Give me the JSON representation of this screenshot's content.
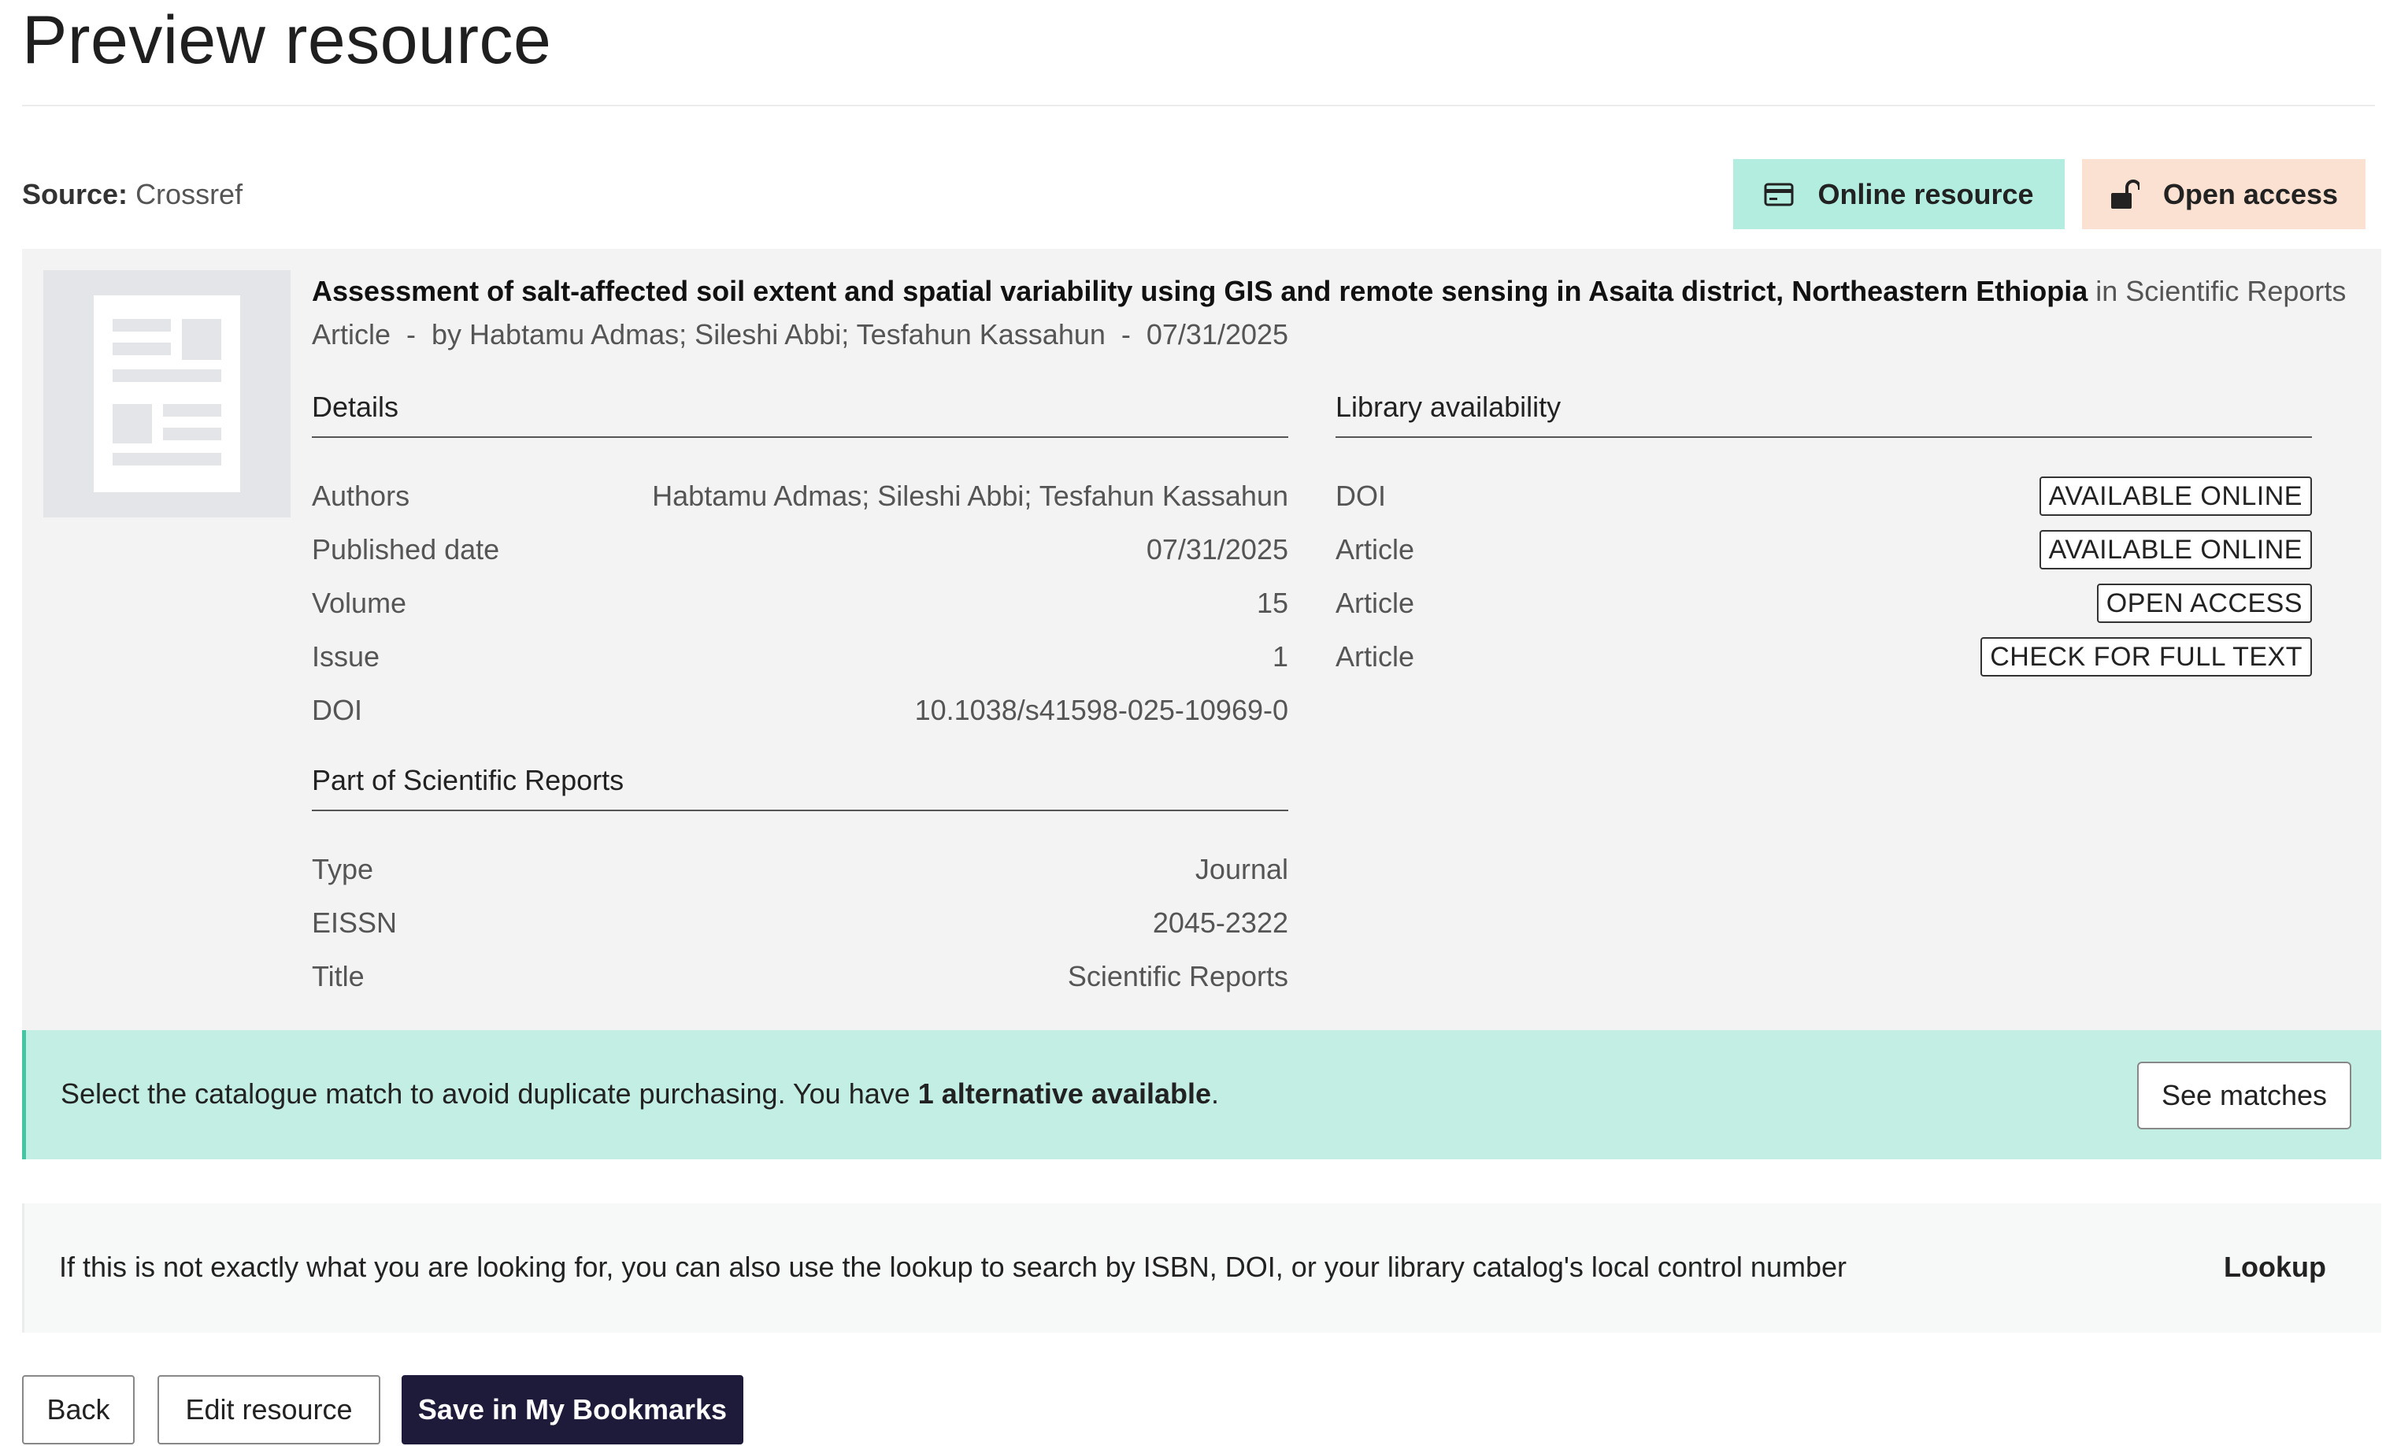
{
  "page": {
    "title": "Preview resource"
  },
  "source": {
    "label": "Source:",
    "value": "Crossref"
  },
  "pills": {
    "online": {
      "label": "Online resource",
      "icon": "credit-card-icon",
      "color": "#b3ede0"
    },
    "open_access": {
      "label": "Open access",
      "icon": "unlock-icon",
      "color": "#fbe1d1"
    }
  },
  "resource": {
    "title": "Assessment of salt-affected soil extent and spatial variability using GIS and remote sensing in Asaita district, Northeastern Ethiopia",
    "in_text": "in Scientific Reports",
    "meta": "Article  -  by Habtamu Admas; Sileshi Abbi; Tesfahun Kassahun  -  07/31/2025"
  },
  "details": {
    "heading": "Details",
    "rows": [
      {
        "label": "Authors",
        "value": "Habtamu Admas; Sileshi Abbi; Tesfahun Kassahun"
      },
      {
        "label": "Published date",
        "value": "07/31/2025"
      },
      {
        "label": "Volume",
        "value": "15"
      },
      {
        "label": "Issue",
        "value": "1"
      },
      {
        "label": "DOI",
        "value": "10.1038/s41598-025-10969-0"
      }
    ]
  },
  "part_of": {
    "heading": "Part of Scientific Reports",
    "rows": [
      {
        "label": "Type",
        "value": "Journal"
      },
      {
        "label": "EISSN",
        "value": "2045-2322"
      },
      {
        "label": "Title",
        "value": "Scientific Reports"
      }
    ]
  },
  "library": {
    "heading": "Library availability",
    "rows": [
      {
        "label": "DOI",
        "badge": "AVAILABLE ONLINE"
      },
      {
        "label": "Article",
        "badge": "AVAILABLE ONLINE"
      },
      {
        "label": "Article",
        "badge": "OPEN ACCESS"
      },
      {
        "label": "Article",
        "badge": "CHECK FOR FULL TEXT"
      }
    ]
  },
  "match_banner": {
    "text_before": "Select the catalogue match to avoid duplicate purchasing. You have ",
    "text_bold": "1 alternative available",
    "text_after": ".",
    "button": "See matches",
    "accent": "#43c6a4"
  },
  "lookup_banner": {
    "text": "If this is not exactly what you are looking for, you can also use the lookup to search by ISBN, DOI, or your library catalog's local control number",
    "link": "Lookup"
  },
  "actions": {
    "back": "Back",
    "edit": "Edit resource",
    "save": "Save in My Bookmarks",
    "primary_color": "#1d1a3a"
  }
}
